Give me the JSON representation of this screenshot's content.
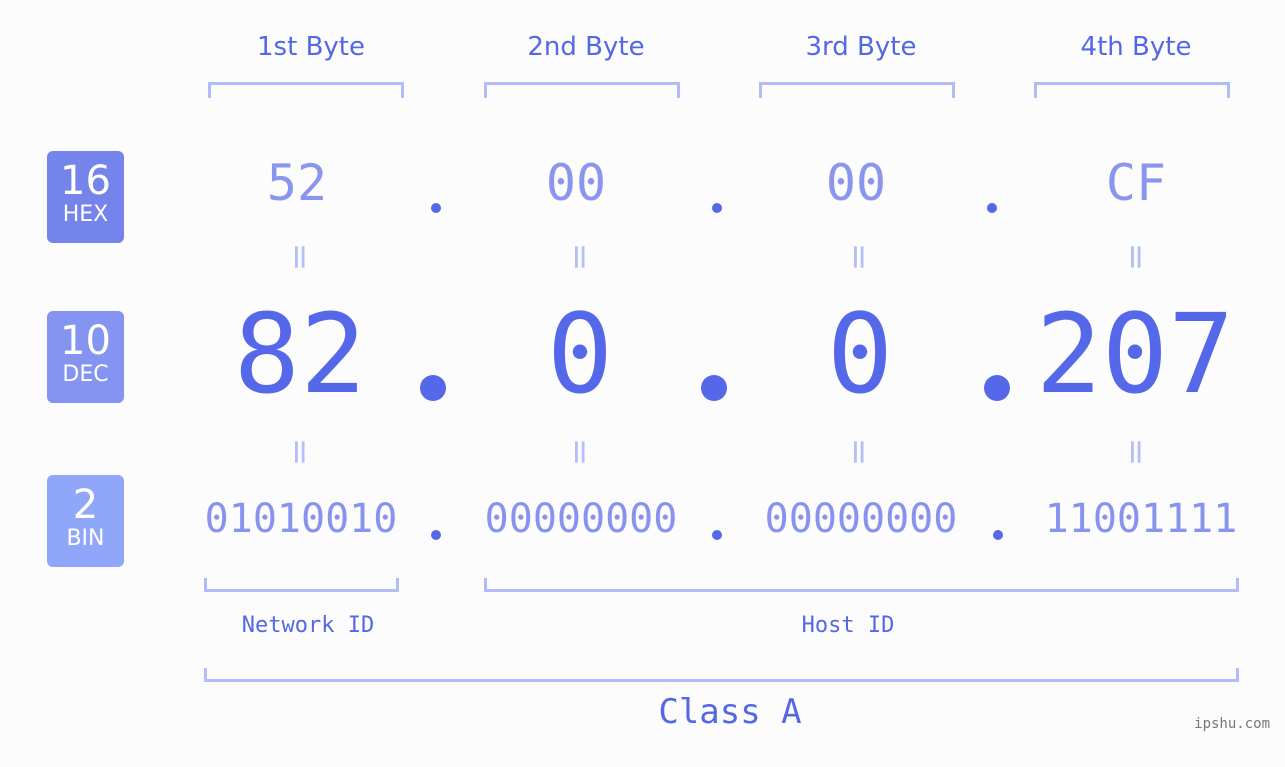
{
  "colors": {
    "accent": "#5468e4",
    "hex_badge": "#7484ea",
    "dec_badge": "#8594f0",
    "bin_badge": "#90a6f8",
    "bracket": "#b2bcf8",
    "light_value": "#8a95ee",
    "background": "#fbfcfb"
  },
  "headers": [
    "1st Byte",
    "2nd Byte",
    "3rd Byte",
    "4th Byte"
  ],
  "badges": {
    "hex": {
      "num": "16",
      "label": "HEX"
    },
    "dec": {
      "num": "10",
      "label": "DEC"
    },
    "bin": {
      "num": "2",
      "label": "BIN"
    }
  },
  "hex": [
    "52",
    "00",
    "00",
    "CF"
  ],
  "dec": [
    "82",
    "0",
    "0",
    "207"
  ],
  "bin": [
    "01010010",
    "00000000",
    "00000000",
    "11001111"
  ],
  "separator": ".",
  "equals": "=",
  "network_id_label": "Network ID",
  "host_id_label": "Host ID",
  "class_label": "Class A",
  "watermark": "ipshu.com"
}
